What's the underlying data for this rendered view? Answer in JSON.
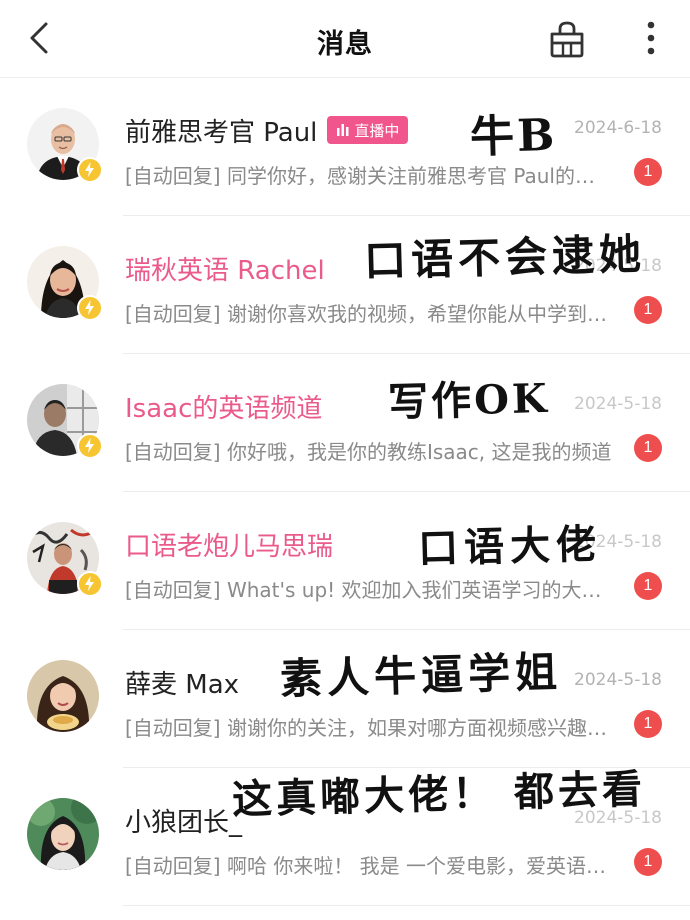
{
  "header": {
    "title": "消息",
    "back_icon": "chevron-left-icon",
    "basket_icon": "basket-icon",
    "more_icon": "more-vertical-icon"
  },
  "conversations": [
    {
      "name": "前雅思考官 Paul",
      "name_color": "normal",
      "live_tag": "直播中",
      "date": "2024-6-18",
      "preview": "[自动回复] 同学你好，感谢关注前雅思考官 Paul的频道",
      "unread": "1",
      "avatar_icon": "avatar-bald-man-suit",
      "annotation": "牛B"
    },
    {
      "name": "瑞秋英语 Rachel",
      "name_color": "pink",
      "date": "2024-5-18",
      "preview": "[自动回复] 谢谢你喜欢我的视频，希望你能从中学到东西",
      "unread": "1",
      "avatar_icon": "avatar-woman-dark-hair",
      "annotation": "口语不会逮她"
    },
    {
      "name": "Isaac的英语频道",
      "name_color": "pink",
      "date": "2024-5-18",
      "preview": "[自动回复] 你好哦，我是你的教练Isaac, 这是我的频道",
      "unread": "1",
      "avatar_icon": "avatar-man-window",
      "annotation": "写作OK"
    },
    {
      "name": "口语老炮儿马思瑞",
      "name_color": "pink",
      "date": "2024-5-18",
      "preview": "[自动回复] What's up! 欢迎加入我们英语学习的大家庭",
      "unread": "1",
      "avatar_icon": "avatar-man-graffiti",
      "annotation": "口语大佬"
    },
    {
      "name": "薛麦 Max",
      "name_color": "normal",
      "date": "2024-5-18",
      "preview": "[自动回复] 谢谢你的关注，如果对哪方面视频感兴趣请留言",
      "unread": "1",
      "avatar_icon": "avatar-woman-eating",
      "annotation": "素人牛逼学姐"
    },
    {
      "name": "小狼团长_",
      "name_color": "normal",
      "date": "2024-5-18",
      "preview": "[自动回复] 啊哈 你来啦！ 我是 一个爱电影，爱英语的人",
      "unread": "1",
      "avatar_icon": "avatar-girl-outdoor",
      "annotation": "这真嘟大佬！ 都去看"
    }
  ],
  "colors": {
    "pink_name": "#ea5a8a",
    "live_tag_bg": "#f0568b",
    "unread_badge": "#ef4e4e",
    "verified_badge": "#f6c531"
  }
}
